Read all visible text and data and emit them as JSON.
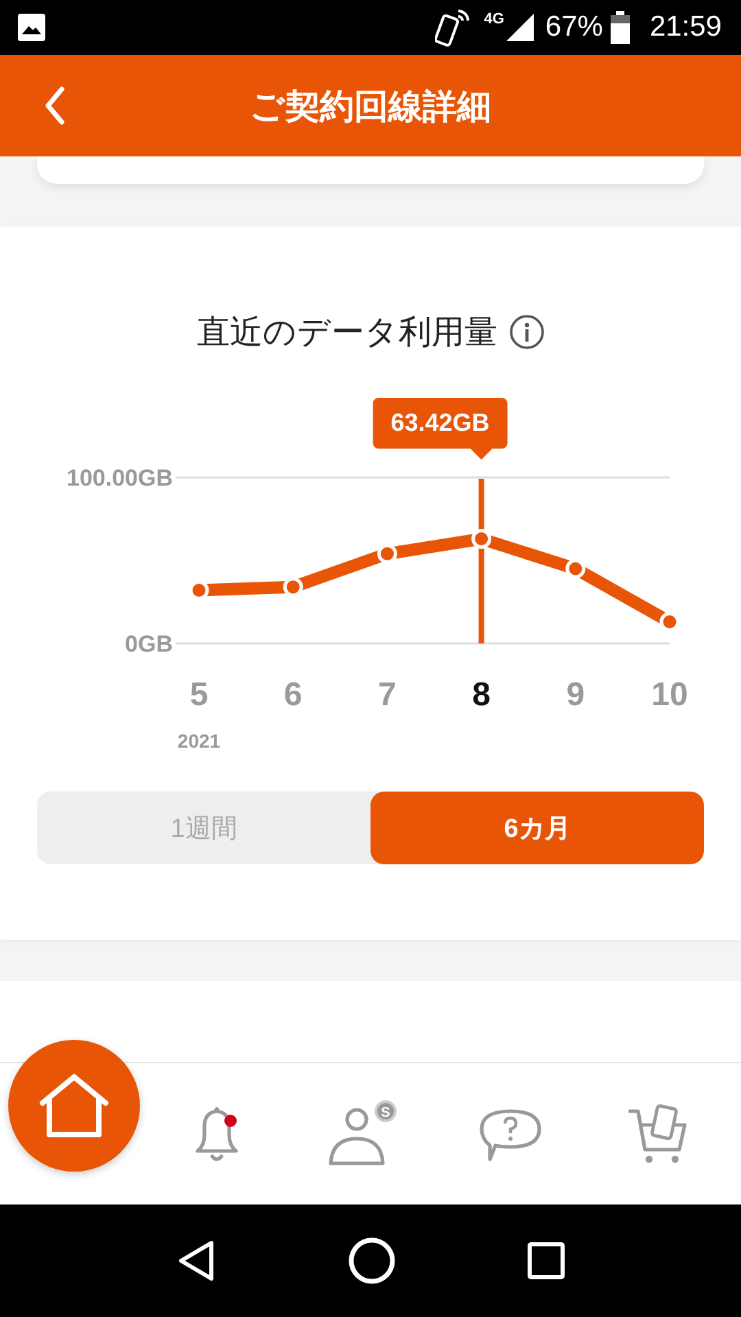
{
  "status_bar": {
    "network": "4G",
    "battery": "67%",
    "time": "21:59"
  },
  "header": {
    "title": "ご契約回線詳細"
  },
  "usage_card": {
    "title": "直近のデータ利用量",
    "chart_data": {
      "type": "line",
      "categories": [
        "5",
        "6",
        "7",
        "8",
        "9",
        "10"
      ],
      "series": [
        {
          "color": "#e95506",
          "marker": "circle",
          "values": [
            32,
            34,
            54,
            63,
            45,
            13
          ]
        }
      ],
      "ref_lines": [
        {
          "axis": "x",
          "value": "8"
        }
      ],
      "ylim": [
        0,
        100
      ],
      "yticks": [
        {
          "value": 0,
          "label": "0GB"
        },
        {
          "value": 100,
          "label": "100.00GB"
        }
      ],
      "annotations": [
        "63.42GB"
      ]
    },
    "year_label": "2021",
    "periods": [
      {
        "label": "1週間",
        "selected": false
      },
      {
        "label": "6カ月",
        "selected": true
      }
    ]
  },
  "bottom_nav": [
    {
      "kind": "home",
      "selected": true
    },
    {
      "kind": "bell",
      "badge": true
    },
    {
      "kind": "person",
      "badge_text": "S"
    },
    {
      "kind": "chat"
    },
    {
      "kind": "cart"
    }
  ]
}
